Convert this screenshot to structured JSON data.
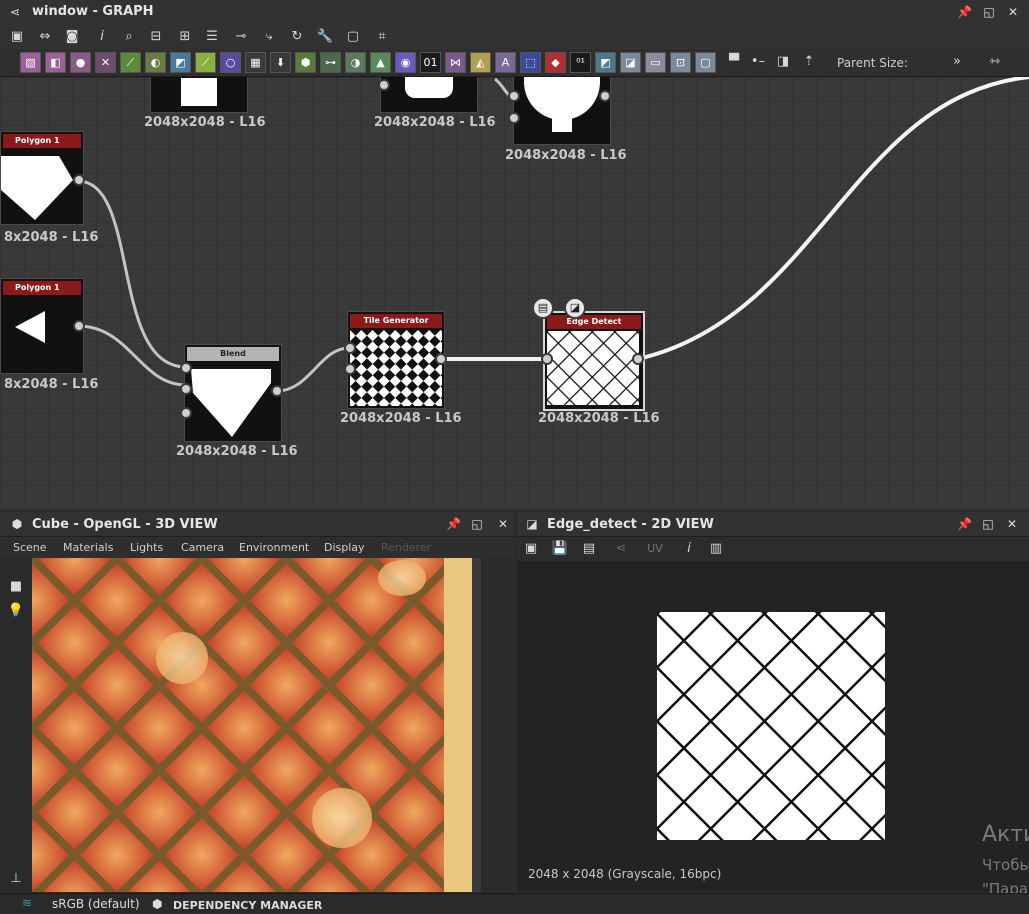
{
  "graph_window": {
    "title": "window - GRAPH",
    "parent_size_label": "Parent Size:",
    "nodes": [
      {
        "name": "Polygon 1",
        "size_label": "8x2048 - L16"
      },
      {
        "name": "Polygon 1",
        "size_label": "8x2048 - L16"
      },
      {
        "name": "Blend",
        "size_label": "2048x2048 - L16"
      },
      {
        "name": "Tile Generator",
        "size_label": "2048x2048 - L16"
      },
      {
        "name": "Edge Detect",
        "size_label": "2048x2048 - L16"
      }
    ],
    "top_node_labels": [
      "2048x2048 - L16",
      "2048x2048 - L16",
      "2048x2048 - L16"
    ]
  },
  "view3d": {
    "title": "Cube - OpenGL - 3D VIEW",
    "menu": [
      "Scene",
      "Materials",
      "Lights",
      "Camera",
      "Environment",
      "Display",
      "Renderer"
    ]
  },
  "view2d": {
    "title": "Edge_detect - 2D VIEW",
    "uv_label": "UV",
    "status": "2048 x 2048 (Grayscale, 16bpc)"
  },
  "watermark": {
    "line1": "Акти",
    "line2": "Чтобы",
    "line3": "\"Пара"
  },
  "bottom_bar": {
    "color_space": "sRGB (default)",
    "dependency_manager": "DEPENDENCY MANAGER"
  },
  "colors": {
    "node_header_red": "#8b1a1a",
    "node_header_gray": "#b4b4b4",
    "wire": "#d0d0d0"
  },
  "icons": [
    "graph-icon",
    "pin-icon",
    "maximize-icon",
    "close-icon",
    "frame-icon",
    "camera-icon",
    "info-icon",
    "search-icon",
    "comment-icon",
    "play-icon",
    "settings-icon"
  ]
}
